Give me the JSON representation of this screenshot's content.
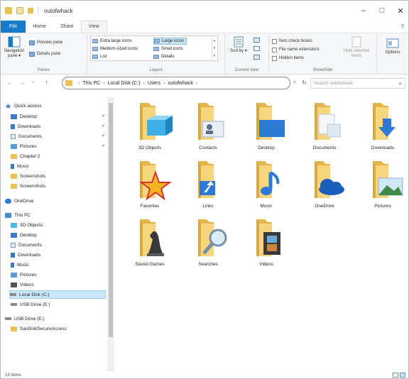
{
  "window": {
    "title": "outofwhack",
    "controls": {
      "minimize": "–",
      "maximize": "□",
      "close": "✕"
    }
  },
  "ribbon_tabs": {
    "file": "File",
    "home": "Home",
    "share": "Share",
    "view": "View",
    "help": "?"
  },
  "ribbon": {
    "panes": {
      "label": "Panes",
      "navigation_pane": "Navigation pane ▾",
      "preview_pane": "Preview pane",
      "details_pane": "Details pane"
    },
    "layout": {
      "label": "Layout",
      "extra_large": "Extra large icons",
      "large": "Large icons",
      "medium": "Medium-sized icons",
      "small": "Small icons",
      "list": "List",
      "details": "Details"
    },
    "current_view": {
      "label": "Current view",
      "sort_by": "Sort by ▾"
    },
    "show_hide": {
      "label": "Show/hide",
      "item_check_boxes": "Item check boxes",
      "file_name_extensions": "File name extensions",
      "hidden_items": "Hidden items",
      "hide_selected": "Hide selected items"
    },
    "options": "Options"
  },
  "address": {
    "back": "←",
    "forward": "→",
    "recent": "˅",
    "up": "↑",
    "crumbs": [
      "This PC",
      "Local Disk (C:)",
      "Users",
      "outofwhack"
    ],
    "crumb_end": "›",
    "dropdown": "˅",
    "refresh": "↻",
    "search_placeholder": "Search outofwhack",
    "search_icon": "⌕"
  },
  "nav_pane": {
    "quick_access": "Quick access",
    "quick_items": [
      "Desktop",
      "Downloads",
      "Documents",
      "Pictures",
      "Chapter 2",
      "Music",
      "Screenshots",
      "Screenshots"
    ],
    "onedrive": "OneDrive",
    "this_pc": "This PC",
    "pc_items": [
      "3D Objects",
      "Desktop",
      "Documents",
      "Downloads",
      "Music",
      "Pictures",
      "Videos",
      "Local Disk (C:)",
      "USB Drive (E:)"
    ],
    "usb": "USB Drive (E:)",
    "usb_items": [
      "SanDiskSecureAccess"
    ]
  },
  "folders": [
    {
      "name": "3D Objects",
      "overlay": "cube-icon"
    },
    {
      "name": "Contacts",
      "overlay": "contact-card-icon"
    },
    {
      "name": "Desktop",
      "overlay": "desktop-icon"
    },
    {
      "name": "Documents",
      "overlay": "document-icon"
    },
    {
      "name": "Downloads",
      "overlay": "download-arrow-icon"
    },
    {
      "name": "Favorites",
      "overlay": "star-icon"
    },
    {
      "name": "Links",
      "overlay": "shortcut-arrow-icon"
    },
    {
      "name": "Music",
      "overlay": "music-note-icon"
    },
    {
      "name": "OneDrive",
      "overlay": "cloud-icon"
    },
    {
      "name": "Pictures",
      "overlay": "landscape-icon"
    },
    {
      "name": "Saved Games",
      "overlay": "chess-icon"
    },
    {
      "name": "Searches",
      "overlay": "magnifier-icon"
    },
    {
      "name": "Videos",
      "overlay": "film-icon"
    }
  ],
  "status": {
    "item_count": "13 items"
  },
  "colors": {
    "folder_back": "#e3b54b",
    "folder_front": "#f6d57c",
    "accent": "#1979ca",
    "selection": "#cce8ff"
  }
}
